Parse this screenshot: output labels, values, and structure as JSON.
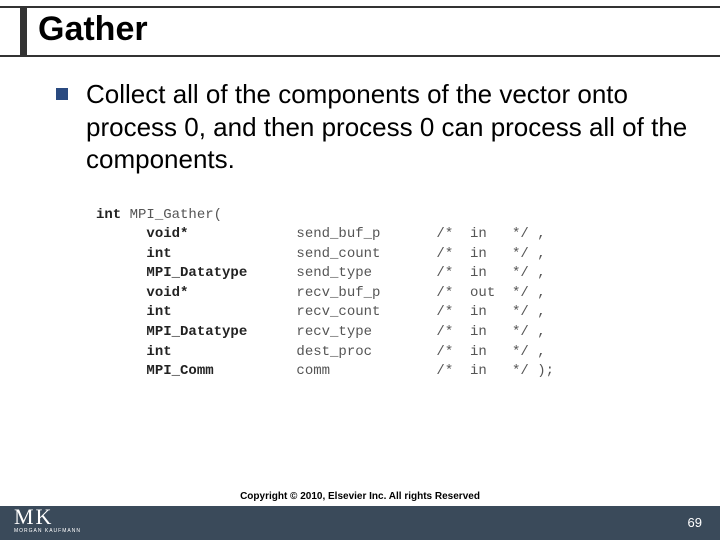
{
  "title": "Gather",
  "bullet_text": "Collect all of the components of the vector onto process 0, and then process 0 can process all of the components.",
  "code": {
    "sig_kw": "int",
    "sig_name": " MPI_Gather(",
    "params": [
      {
        "type": "void*",
        "name": "send_buf_p",
        "dir": "in",
        "end": "*/ ,"
      },
      {
        "type": "int",
        "name": "send_count",
        "dir": "in",
        "end": "*/ ,"
      },
      {
        "type": "MPI_Datatype",
        "name": "send_type",
        "dir": "in",
        "end": "*/ ,"
      },
      {
        "type": "void*",
        "name": "recv_buf_p",
        "dir": "out",
        "end": "*/ ,"
      },
      {
        "type": "int",
        "name": "recv_count",
        "dir": "in",
        "end": "*/ ,"
      },
      {
        "type": "MPI_Datatype",
        "name": "recv_type",
        "dir": "in",
        "end": "*/ ,"
      },
      {
        "type": "int",
        "name": "dest_proc",
        "dir": "in",
        "end": "*/ ,"
      },
      {
        "type": "MPI_Comm",
        "name": "comm",
        "dir": "in",
        "end": "*/ );"
      }
    ]
  },
  "logo": {
    "main": "MK",
    "sub": "MORGAN KAUFMANN"
  },
  "copyright": "Copyright © 2010, Elsevier Inc. All rights Reserved",
  "page_number": "69"
}
